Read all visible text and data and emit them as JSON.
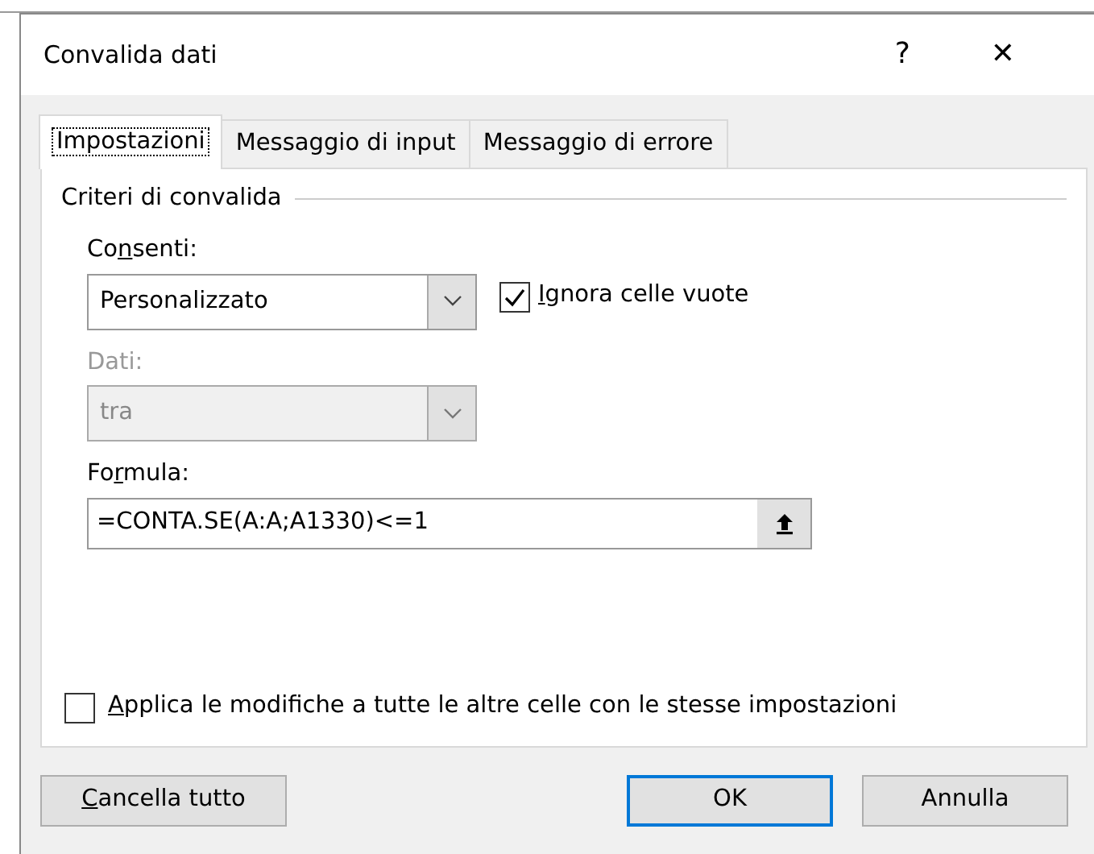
{
  "window": {
    "title": "Convalida dati",
    "help": "?",
    "close": "✕"
  },
  "tabs": [
    {
      "label": "Impostazioni",
      "selected": true
    },
    {
      "label": "Messaggio di input",
      "selected": false
    },
    {
      "label": "Messaggio di errore",
      "selected": false
    }
  ],
  "group": {
    "title": "Criteri di convalida"
  },
  "allow": {
    "label": {
      "before": "Co",
      "key": "n",
      "after": "senti:"
    },
    "value": "Personalizzato",
    "disabled": false
  },
  "ignore_blank": {
    "label": {
      "key": "I",
      "after": "gnora celle vuote"
    },
    "checked": true
  },
  "data": {
    "label": {
      "before": "Dati:"
    },
    "value": "tra",
    "disabled": true
  },
  "formula": {
    "label": {
      "before": "Fo",
      "key": "r",
      "after": "mula:"
    },
    "value": "=CONTA.SE(A:A;A1330)<=1"
  },
  "apply_all": {
    "label": {
      "key": "A",
      "after": "pplica le modifiche a tutte le altre celle con le stesse impostazioni"
    },
    "checked": false
  },
  "buttons": [
    {
      "label": {
        "key": "C",
        "after": "ancella tutto"
      },
      "kind": "left",
      "default": false
    },
    {
      "label": {
        "before": "OK"
      },
      "kind": "right",
      "default": true
    },
    {
      "label": {
        "before": "Annulla"
      },
      "kind": "right",
      "default": false
    }
  ]
}
